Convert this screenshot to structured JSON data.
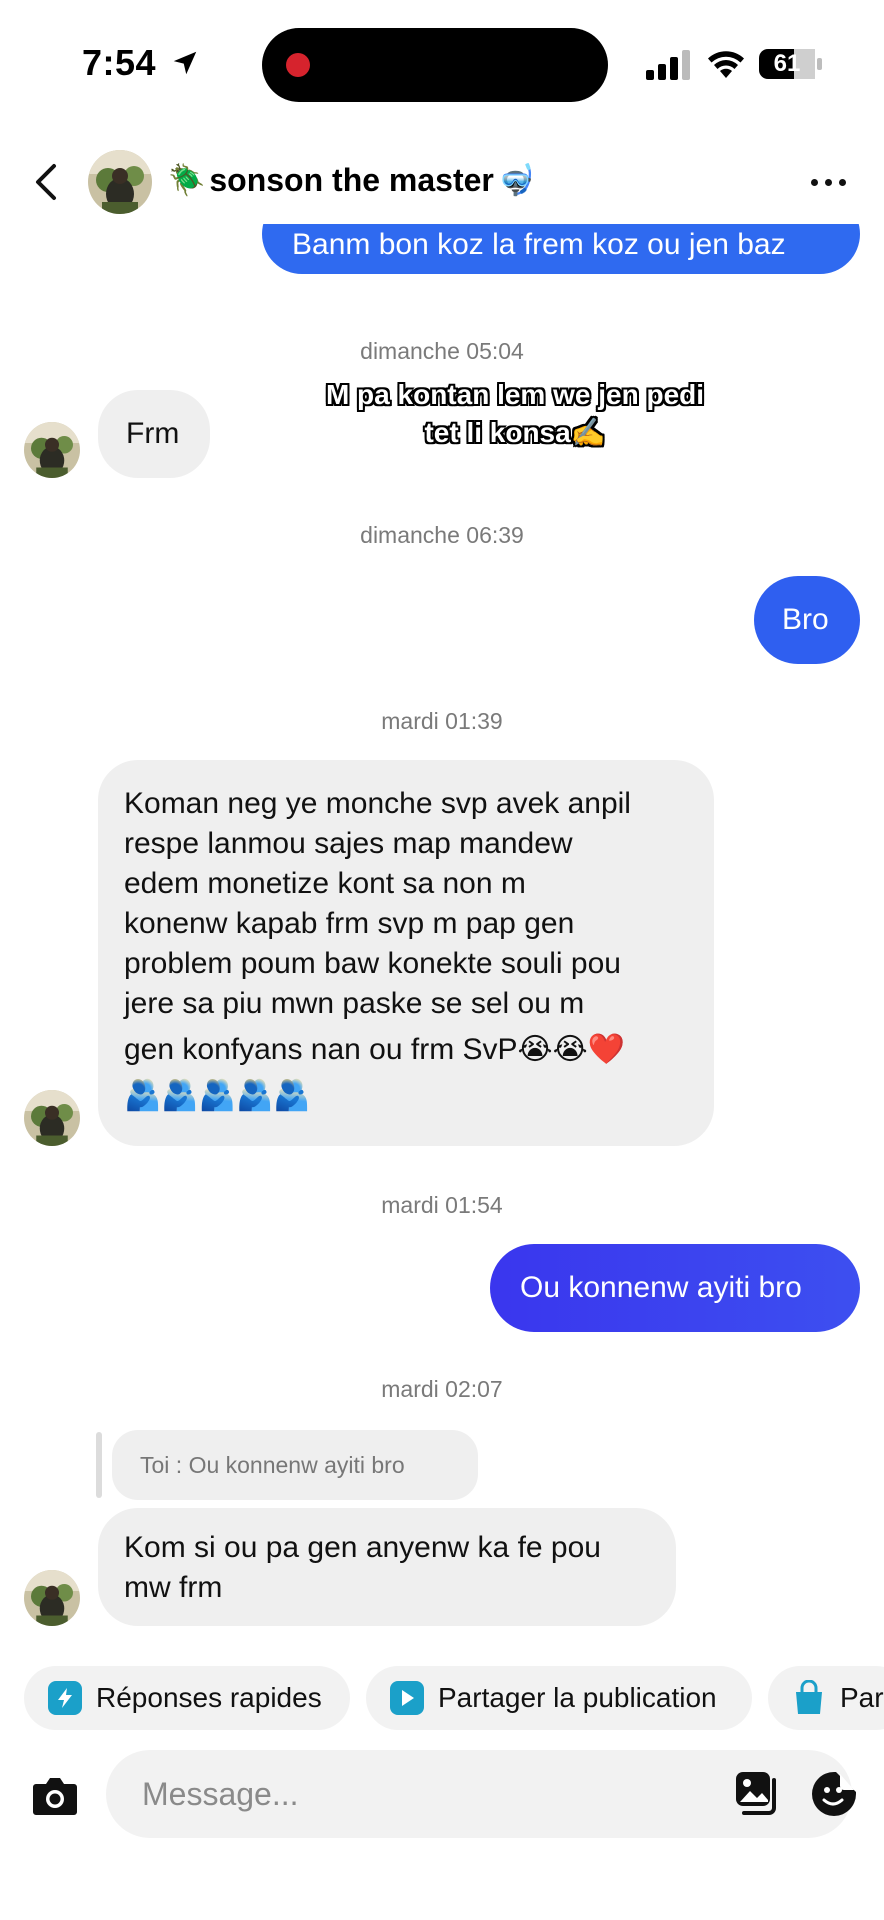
{
  "status_bar": {
    "time": "7:54",
    "battery": "61"
  },
  "header": {
    "contact_name": "sonson the master",
    "name_prefix_emoji": "🪲",
    "name_suffix_emoji": "🤿"
  },
  "overlay_caption": [
    "M pa kontan lem we jen pedi",
    "tet li konsa✍️"
  ],
  "messages": [
    {
      "type": "outgoing",
      "text": "Banm bon koz la frem koz ou jen baz"
    },
    {
      "type": "timestamp",
      "text": "dimanche 05:04"
    },
    {
      "type": "incoming",
      "text": "Frm"
    },
    {
      "type": "timestamp",
      "text": "dimanche 06:39"
    },
    {
      "type": "outgoing",
      "text": "Bro"
    },
    {
      "type": "timestamp",
      "text": "mardi 01:39"
    },
    {
      "type": "incoming",
      "lines": [
        "Koman neg ye monche svp avek anpil",
        "respe lanmou sajes map mandew",
        "edem monetize kont sa non m",
        "konenw kapab frm svp m pap gen",
        "problem poum baw konekte souli pou",
        "jere sa piu mwn paske se sel ou m",
        "gen konfyans nan ou frm SvP😭😭❤️",
        "🫂🫂🫂🫂🫂"
      ]
    },
    {
      "type": "timestamp",
      "text": "mardi 01:54"
    },
    {
      "type": "outgoing",
      "text": "Ou konnenw ayiti bro"
    },
    {
      "type": "timestamp",
      "text": "mardi 02:07"
    },
    {
      "type": "reply_quote",
      "text": "Toi : Ou konnenw ayiti bro"
    },
    {
      "type": "incoming",
      "lines": [
        "Kom si ou pa gen anyenw ka fe pou",
        "mw frm"
      ]
    }
  ],
  "quick_actions": [
    {
      "label": "Réponses rapides",
      "icon": "lightning-chat-icon",
      "color": "#1ba0c9"
    },
    {
      "label": "Partager la publication",
      "icon": "play-square-icon",
      "color": "#1ba0c9"
    },
    {
      "label": "Par",
      "icon": "shopping-bag-icon",
      "color": "#1ba0c9"
    }
  ],
  "composer": {
    "placeholder": "Message..."
  },
  "colors": {
    "outgoing_blue": "#2f6af0",
    "outgoing_violet": "#3c3af0",
    "incoming_bg": "#efefef",
    "timestamp": "#7a7a7a"
  }
}
